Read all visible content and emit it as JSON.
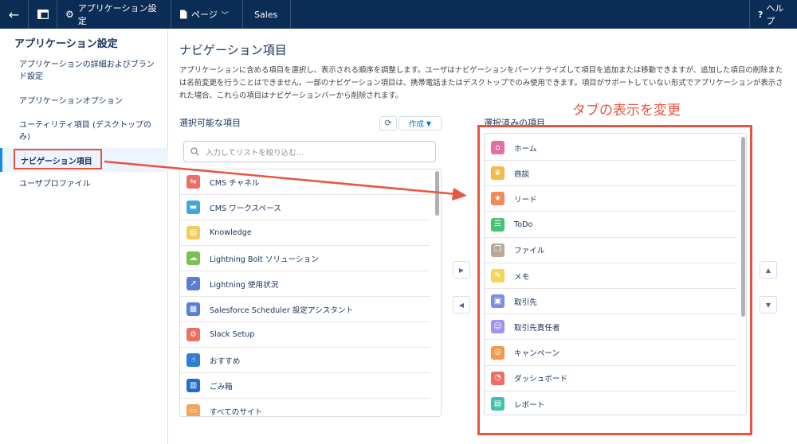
{
  "topbar": {
    "setup_label": "アプリケーション設定",
    "page_label": "ページ",
    "app_name": "Sales",
    "help_label": "ヘルプ"
  },
  "sidebar": {
    "title": "アプリケーション設定",
    "items": [
      {
        "label": "アプリケーションの詳細およびブランド設定"
      },
      {
        "label": "アプリケーションオプション"
      },
      {
        "label": "ユーティリティ項目 (デスクトップのみ)"
      },
      {
        "label": "ナビゲーション項目"
      },
      {
        "label": "ユーザプロファイル"
      }
    ]
  },
  "main": {
    "title": "ナビゲーション項目",
    "description": "アプリケーションに含める項目を選択し、表示される順序を調整します。ユーザはナビゲーションをパーソナライズして項目を追加または移動できますが、追加した項目の削除または名前変更を行うことはできません。一部のナビゲーション項目は、携帯電話またはデスクトップでのみ使用できます。項目がサポートしていない形式でアプリケーションが表示された場合、これらの項目はナビゲーションバーから削除されます。",
    "available_title": "選択可能な項目",
    "selected_title": "選択済みの項目",
    "refresh_icon": "refresh-icon",
    "create_label": "作成",
    "search_placeholder": "入力してリストを絞り込む...",
    "available_items": [
      {
        "label": "CMS チャネル",
        "icon": "share-icon",
        "color": "#ef6e64"
      },
      {
        "label": "CMS ワークスペース",
        "icon": "folder-icon",
        "color": "#3ea8d6"
      },
      {
        "label": "Knowledge",
        "icon": "book-icon",
        "color": "#f5cb5c"
      },
      {
        "label": "Lightning Bolt ソリューション",
        "icon": "bolt-icon",
        "color": "#78c150"
      },
      {
        "label": "Lightning 使用状況",
        "icon": "chart-icon",
        "color": "#5b7bd5"
      },
      {
        "label": "Salesforce Scheduler 設定アシスタント",
        "icon": "calendar-icon",
        "color": "#5b7bd5"
      },
      {
        "label": "Slack Setup",
        "icon": "gears-icon",
        "color": "#ef6e64"
      },
      {
        "label": "おすすめ",
        "icon": "hand-icon",
        "color": "#2e7fd4"
      },
      {
        "label": "ごみ箱",
        "icon": "trash-icon",
        "color": "#1f6fc9"
      },
      {
        "label": "すべてのサイト",
        "icon": "site-icon",
        "color": "#f5a25c"
      }
    ],
    "selected_items": [
      {
        "label": "ホーム",
        "icon": "home-icon",
        "color": "#e36ea4"
      },
      {
        "label": "商談",
        "icon": "crown-icon",
        "color": "#f5b94a"
      },
      {
        "label": "リード",
        "icon": "star-person-icon",
        "color": "#f08a5d"
      },
      {
        "label": "ToDo",
        "icon": "checklist-icon",
        "color": "#4bc076"
      },
      {
        "label": "ファイル",
        "icon": "file-icon",
        "color": "#b8a99a"
      },
      {
        "label": "メモ",
        "icon": "note-icon",
        "color": "#f5d55a"
      },
      {
        "label": "取引先",
        "icon": "account-icon",
        "color": "#7f8de1"
      },
      {
        "label": "取引先責任者",
        "icon": "contact-icon",
        "color": "#a094ed"
      },
      {
        "label": "キャンペーン",
        "icon": "target-icon",
        "color": "#f59a4a"
      },
      {
        "label": "ダッシュボード",
        "icon": "gauge-icon",
        "color": "#ef6e64"
      },
      {
        "label": "レポート",
        "icon": "report-icon",
        "color": "#3fc1b0"
      }
    ]
  },
  "annotation": {
    "text": "タブの表示を変更",
    "color": "#e8553e"
  }
}
